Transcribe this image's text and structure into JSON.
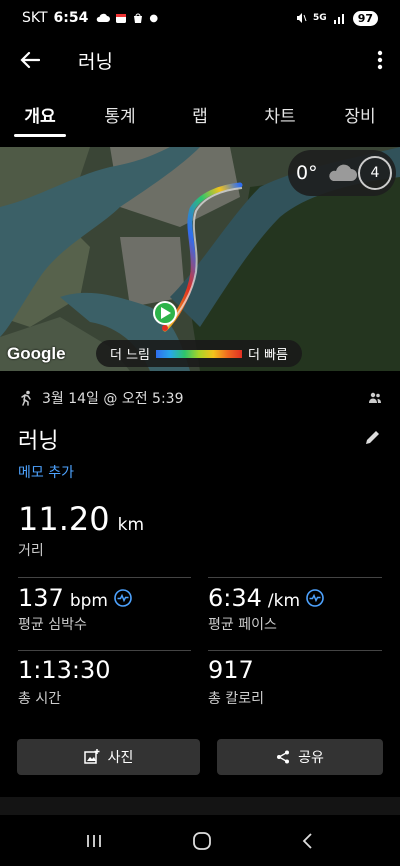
{
  "status": {
    "carrier": "SKT",
    "time": "6:54",
    "battery": "97",
    "network": "5G"
  },
  "appbar": {
    "title": "러닝"
  },
  "tabs": [
    {
      "label": "개요",
      "active": true
    },
    {
      "label": "통계",
      "active": false
    },
    {
      "label": "랩",
      "active": false
    },
    {
      "label": "차트",
      "active": false
    },
    {
      "label": "장비",
      "active": false
    }
  ],
  "map": {
    "weather_temp": "0°",
    "weather_badge": "4",
    "google_label": "Google",
    "legend_slow": "더 느림",
    "legend_fast": "더 빠름"
  },
  "activity": {
    "date": "3월 14일 @ 오전 5:39",
    "title": "러닝",
    "memo": "메모 추가",
    "distance": {
      "value": "11.20",
      "unit": "km",
      "label": "거리"
    },
    "heart_rate": {
      "value": "137",
      "unit": "bpm",
      "label": "평균 심박수"
    },
    "pace": {
      "value": "6:34",
      "unit": "/km",
      "label": "평균 페이스"
    },
    "total_time": {
      "value": "1:13:30",
      "label": "총 시간"
    },
    "calories": {
      "value": "917",
      "label": "총 칼로리"
    }
  },
  "buttons": {
    "photo": "사진",
    "share": "공유"
  },
  "colors": {
    "accent": "#4ea3ff",
    "button_bg": "#333333"
  }
}
